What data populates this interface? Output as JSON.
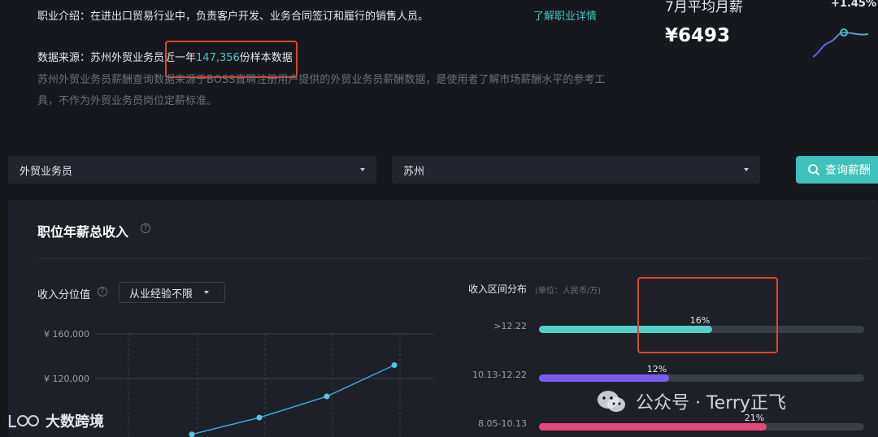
{
  "colors": {
    "background": "#16181e",
    "panel": "#1d2027",
    "accent_teal": "#3ec1bb",
    "accent_purple": "#7b5cf0",
    "accent_pink": "#e9467a",
    "highlight_red": "#d8472f"
  },
  "intro": {
    "job_intro_text": "职业介绍：在进出口贸易行业中，负责客户开发、业务合同签订和履行的销售人员。",
    "learn_more_link": "了解职业详情",
    "source_prefix": "数据来源：苏州外贸业务员",
    "source_mid": "近一年",
    "source_count": "147,356",
    "source_suffix": "份样本数据",
    "description": "苏州外贸业务员薪酬查询数据来源于BOSS直聘注册用户提供的外贸业务员薪酬数据，是使用者了解市场薪酬水平的参考工具，不作为外贸业务员岗位定薪标准。"
  },
  "avg_card": {
    "title": "7月平均月薪",
    "change": "+1.45%",
    "amount": "¥6493"
  },
  "filters": {
    "job_select": "外贸业务员",
    "city_select": "苏州",
    "query_button": "查询薪酬",
    "search_icon": "search-icon"
  },
  "section": {
    "title": "职位年薪总收入",
    "help_icon": "question-icon"
  },
  "percentile": {
    "title": "收入分位值",
    "experience_dropdown": "从业经验不限",
    "y_ticks": [
      "¥ 160,000",
      "¥ 120,000"
    ]
  },
  "distribution": {
    "title": "收入区间分布",
    "unit": "(单位：人民币/万)",
    "rows": [
      {
        "label": ">12.22",
        "percent_text": "16%",
        "value": 0.16,
        "color": "#53d1c8"
      },
      {
        "label": "10.13-12.22",
        "percent_text": "12%",
        "value": 0.12,
        "color": "#7b5cf0"
      },
      {
        "label": "8.05-10.13",
        "percent_text": "21%",
        "value": 0.21,
        "color": "#e9467a"
      }
    ]
  },
  "chart_data": {
    "type": "line",
    "y_ticks": [
      "¥ 160,000",
      "¥ 120,000"
    ],
    "series": [
      {
        "values": [
          70000,
          85000,
          104000,
          132000
        ]
      }
    ],
    "ylim": [
      70000,
      170000
    ]
  },
  "watermarks": {
    "left": "大数跨境",
    "right": "公众号 · Terry正飞"
  }
}
